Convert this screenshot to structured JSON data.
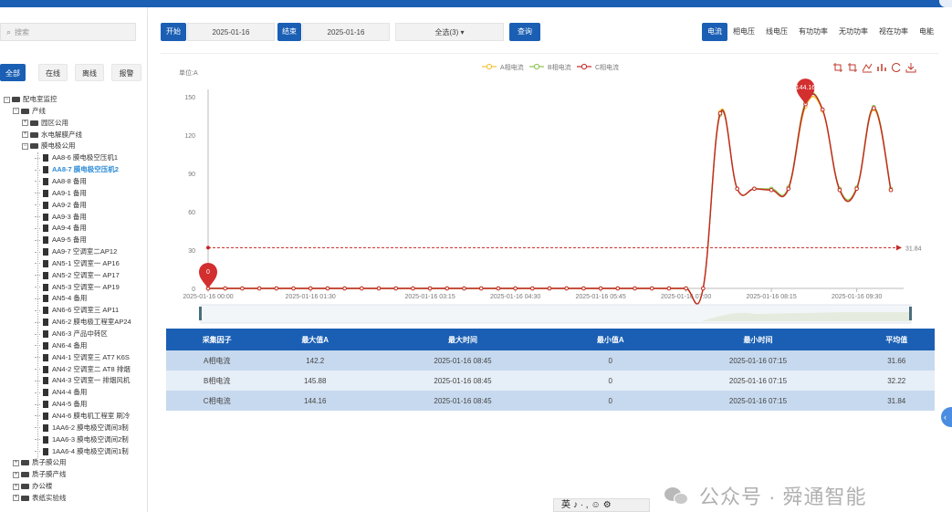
{
  "sidebar": {
    "search_placeholder": "搜索",
    "filter_tabs": [
      "全部",
      "在线",
      "离线",
      "报警"
    ],
    "tree": [
      {
        "label": "配电室监控",
        "level": 0,
        "type": "folder",
        "toggle": "−"
      },
      {
        "label": "产线",
        "level": 1,
        "type": "folder",
        "toggle": "−"
      },
      {
        "label": "园区公用",
        "level": 2,
        "type": "folder",
        "toggle": "+"
      },
      {
        "label": "水电解膜产线",
        "level": 2,
        "type": "folder",
        "toggle": "+"
      },
      {
        "label": "膜电极公用",
        "level": 2,
        "type": "folder",
        "toggle": "−"
      },
      {
        "label": "AA8-6 膜电极空压机1",
        "level": 3,
        "type": "file"
      },
      {
        "label": "AA8-7 膜电极空压机2",
        "level": 3,
        "type": "file",
        "selected": true
      },
      {
        "label": "AA8-8 备用",
        "level": 3,
        "type": "file"
      },
      {
        "label": "AA9-1 备用",
        "level": 3,
        "type": "file"
      },
      {
        "label": "AA9-2 备用",
        "level": 3,
        "type": "file"
      },
      {
        "label": "AA9-3 备用",
        "level": 3,
        "type": "file"
      },
      {
        "label": "AA9-4 备用",
        "level": 3,
        "type": "file"
      },
      {
        "label": "AA9-5 备用",
        "level": 3,
        "type": "file"
      },
      {
        "label": "AA9-7 空调室二AP12",
        "level": 3,
        "type": "file"
      },
      {
        "label": "AN5-1 空调室一 AP16",
        "level": 3,
        "type": "file"
      },
      {
        "label": "AN5-2 空调室一 AP17",
        "level": 3,
        "type": "file"
      },
      {
        "label": "AN5-3 空调室一 AP19",
        "level": 3,
        "type": "file"
      },
      {
        "label": "AN5-4 备用",
        "level": 3,
        "type": "file"
      },
      {
        "label": "AN6-6 空调室三 AP11",
        "level": 3,
        "type": "file"
      },
      {
        "label": "AN6-2 膜电极工程室AP24",
        "level": 3,
        "type": "file"
      },
      {
        "label": "AN6-3 产品中转区",
        "level": 3,
        "type": "file"
      },
      {
        "label": "AN6-4 备用",
        "level": 3,
        "type": "file"
      },
      {
        "label": "AN4-1 空调室三 AT7 K6S",
        "level": 3,
        "type": "file"
      },
      {
        "label": "AN4-2 空调室二 AT8 排烟",
        "level": 3,
        "type": "file"
      },
      {
        "label": "AN4-3 空调室一 排烟风机",
        "level": 3,
        "type": "file"
      },
      {
        "label": "AN4-4 备用",
        "level": 3,
        "type": "file"
      },
      {
        "label": "AN4-5 备用",
        "level": 3,
        "type": "file"
      },
      {
        "label": "AN4-6 膜电机工程室 刷冷",
        "level": 3,
        "type": "file"
      },
      {
        "label": "1AA6-2 膜电极空调间3制",
        "level": 3,
        "type": "file"
      },
      {
        "label": "1AA6-3 膜电极空调间2制",
        "level": 3,
        "type": "file"
      },
      {
        "label": "1AA6-4 膜电极空调间1制",
        "level": 3,
        "type": "file"
      },
      {
        "label": "质子膜公用",
        "level": 1,
        "type": "folder",
        "toggle": "+"
      },
      {
        "label": "质子膜产线",
        "level": 1,
        "type": "folder",
        "toggle": "+"
      },
      {
        "label": "办公楼",
        "level": 1,
        "type": "folder",
        "toggle": "+"
      },
      {
        "label": "表纸实验线",
        "level": 1,
        "type": "folder",
        "toggle": "+"
      }
    ]
  },
  "toolbar": {
    "start_label": "开始",
    "start_date": "2025-01-16",
    "end_label": "结束",
    "end_date": "2025-01-16",
    "select_value": "全选(3) ▾",
    "query_label": "查询"
  },
  "metric_tabs": [
    "电流",
    "相电压",
    "线电压",
    "有功功率",
    "无功功率",
    "视在功率",
    "电能"
  ],
  "chart_tools": [
    "crop-icon",
    "crop-reset-icon",
    "line-chart-icon",
    "bar-chart-icon",
    "refresh-icon",
    "download-icon"
  ],
  "chart_data": {
    "type": "line",
    "ylabel": "单位:A",
    "ylim": [
      0,
      150
    ],
    "y_ticks": [
      "0",
      "30",
      "60",
      "90",
      "120",
      "150"
    ],
    "x_ticks": [
      "2025-01-16 00:00",
      "2025-01-16 01:30",
      "2025-01-16 03:15",
      "2025-01-16 04:30",
      "2025-01-16 05:45",
      "2025-01-16 07:00",
      "2025-01-16 08:15",
      "2025-01-16 09:30"
    ],
    "x": [
      "00:00",
      "00:15",
      "00:30",
      "00:45",
      "01:00",
      "01:15",
      "01:30",
      "01:45",
      "02:00",
      "02:15",
      "02:30",
      "02:45",
      "03:00",
      "03:15",
      "03:30",
      "03:45",
      "04:00",
      "04:15",
      "04:30",
      "04:45",
      "05:00",
      "05:15",
      "05:30",
      "05:45",
      "06:00",
      "06:15",
      "06:30",
      "06:45",
      "07:00",
      "07:15",
      "07:30",
      "07:45",
      "08:00",
      "08:15",
      "08:30",
      "08:45",
      "09:00",
      "09:15",
      "09:30",
      "09:45",
      "10:00"
    ],
    "series": [
      {
        "name": "A相电流",
        "color": "#f2c230",
        "values": [
          0,
          0,
          0,
          0,
          0,
          0,
          0,
          0,
          0,
          0,
          0,
          0,
          0,
          0,
          0,
          0,
          0,
          0,
          0,
          0,
          0,
          0,
          0,
          0,
          0,
          0,
          0,
          0,
          0,
          0,
          138,
          78,
          78,
          77,
          78,
          142.2,
          139,
          77,
          78,
          140,
          77
        ]
      },
      {
        "name": "B相电流",
        "color": "#8bc34a",
        "values": [
          0,
          0,
          0,
          0,
          0,
          0,
          0,
          0,
          0,
          0,
          0,
          0,
          0,
          0,
          0,
          0,
          0,
          0,
          0,
          0,
          0,
          0,
          0,
          0,
          0,
          0,
          0,
          0,
          0,
          0,
          136,
          78,
          78,
          78,
          79,
          145.88,
          140,
          78,
          79,
          142,
          78
        ]
      },
      {
        "name": "C相电流",
        "color": "#c62828",
        "values": [
          0,
          0,
          0,
          0,
          0,
          0,
          0,
          0,
          0,
          0,
          0,
          0,
          0,
          0,
          0,
          0,
          0,
          0,
          0,
          0,
          0,
          0,
          0,
          0,
          0,
          0,
          0,
          0,
          0,
          0,
          137,
          78,
          78,
          77,
          78,
          144.16,
          140,
          77,
          78,
          141,
          77
        ]
      }
    ],
    "markers": [
      {
        "label": "0",
        "x": "00:00",
        "y": 0
      },
      {
        "label": "144.16",
        "x": "08:45",
        "y": 144.16
      }
    ],
    "average_line": {
      "value": 31.84,
      "label": "31.84"
    }
  },
  "table": {
    "headers": [
      "采集因子",
      "最大值A",
      "最大时间",
      "最小值A",
      "最小时间",
      "平均值"
    ],
    "rows": [
      [
        "A相电流",
        "142.2",
        "2025-01-16 08:45",
        "0",
        "2025-01-16 07:15",
        "31.66"
      ],
      [
        "B相电流",
        "145.88",
        "2025-01-16 08:45",
        "0",
        "2025-01-16 07:15",
        "32.22"
      ],
      [
        "C相电流",
        "144.16",
        "2025-01-16 08:45",
        "0",
        "2025-01-16 07:15",
        "31.84"
      ]
    ]
  },
  "ime_bar": "英♪∙,☺⚙",
  "watermark": "公众号 · 舜通智能"
}
